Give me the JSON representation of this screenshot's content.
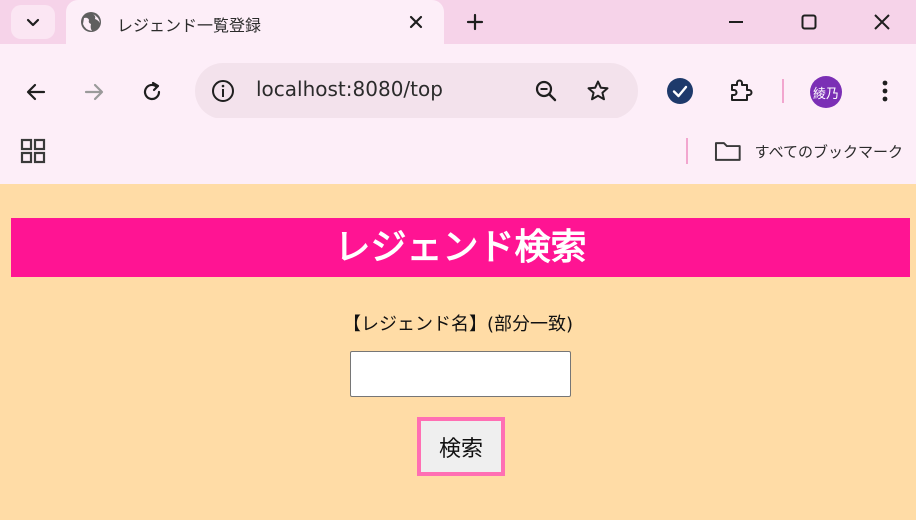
{
  "browser": {
    "tab": {
      "title": "レジェンド一覧登録",
      "favicon": "globe-icon"
    },
    "address_bar": {
      "url": "localhost:8080/top"
    },
    "avatar_label": "綾乃",
    "bookmarks": {
      "all_bookmarks_label": "すべてのブックマーク"
    },
    "colors": {
      "tabstrip": "#f6d3e9",
      "toolbar": "#fdeef8",
      "accent": "#f2a6cf"
    }
  },
  "page": {
    "heading": "レジェンド検索",
    "field_label": "【レジェンド名】(部分一致)",
    "name_input": {
      "value": "",
      "placeholder": ""
    },
    "search_button_label": "検索",
    "colors": {
      "background": "#ffdca6",
      "heading_bg": "#ff1493",
      "heading_text": "#ffffff",
      "button_border": "#ff6fb3"
    }
  }
}
